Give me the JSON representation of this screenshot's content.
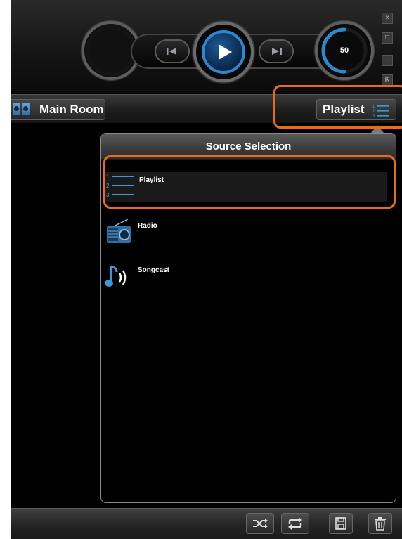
{
  "room": {
    "name": "Main Room"
  },
  "source_button": {
    "label": "Playlist"
  },
  "transport": {
    "volume": "50",
    "volume_fraction": 0.5
  },
  "window_controls": {
    "close": "×",
    "maximize": "□",
    "minimize": "–",
    "compact": "K"
  },
  "popover": {
    "title": "Source Selection",
    "items": [
      {
        "label": "Playlist",
        "icon": "playlist-icon",
        "selected": true
      },
      {
        "label": "Radio",
        "icon": "radio-icon",
        "selected": false
      },
      {
        "label": "Songcast",
        "icon": "songcast-icon",
        "selected": false
      }
    ]
  },
  "colors": {
    "accent": "#2a8ad0",
    "highlight": "#ec6a19",
    "background": "#000000"
  },
  "bottom_toolbar": [
    "shuffle-icon",
    "repeat-icon",
    "save-icon",
    "delete-icon"
  ]
}
